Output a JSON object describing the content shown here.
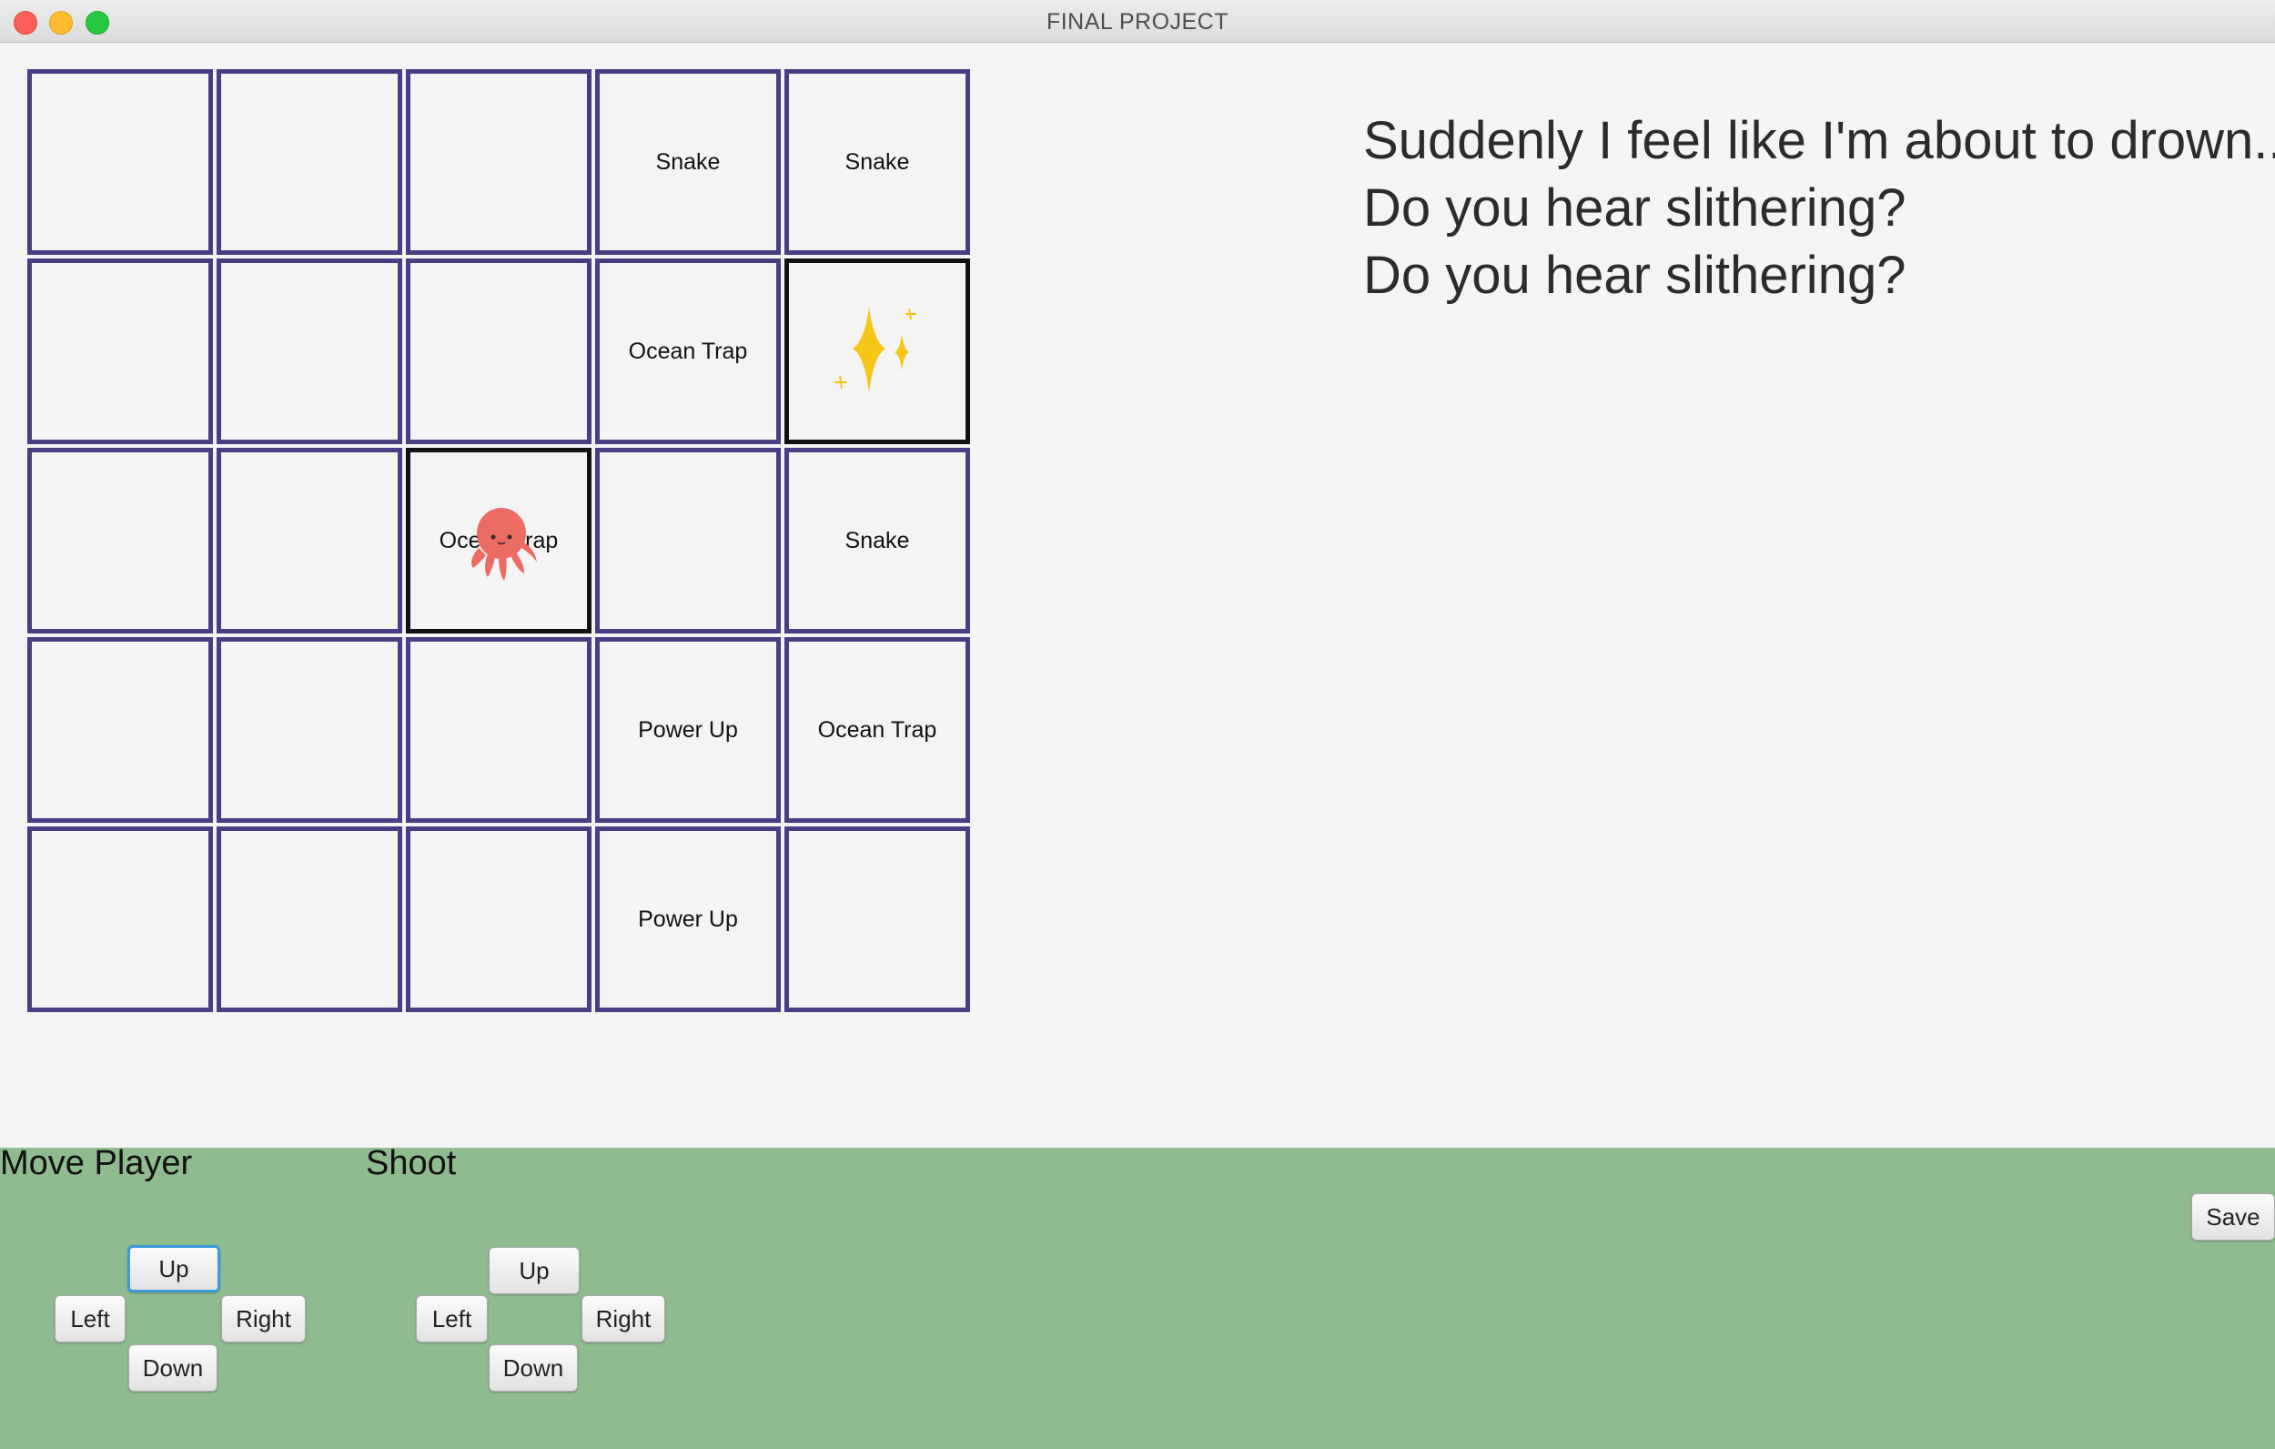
{
  "window": {
    "title": "FINAL PROJECT"
  },
  "grid": {
    "rows": [
      [
        "",
        "",
        "",
        "Snake",
        "Snake"
      ],
      [
        "",
        "",
        "",
        "Ocean Trap",
        ""
      ],
      [
        "",
        "",
        "Ocean Trap",
        "",
        "Snake"
      ],
      [
        "",
        "",
        "",
        "Power Up",
        "Ocean Trap"
      ],
      [
        "",
        "",
        "",
        "Power Up",
        ""
      ]
    ],
    "player": {
      "row": 2,
      "col": 2,
      "icon": "octopus-icon"
    },
    "sparkle": {
      "row": 1,
      "col": 4,
      "icon": "sparkle-icon"
    }
  },
  "messages": [
    "Suddenly I feel like I'm about to drown...",
    "Do you hear slithering?",
    "Do you hear slithering?"
  ],
  "controls": {
    "move": {
      "title": "Move Player",
      "up": "Up",
      "left": "Left",
      "right": "Right",
      "down": "Down"
    },
    "shoot": {
      "title": "Shoot",
      "up": "Up",
      "left": "Left",
      "right": "Right",
      "down": "Down"
    },
    "save": "Save"
  },
  "colors": {
    "cell_border": "#4a3d84",
    "panel_bg": "#8fbc8f",
    "sparkle": "#f5c518",
    "octopus": "#ec6b62"
  }
}
